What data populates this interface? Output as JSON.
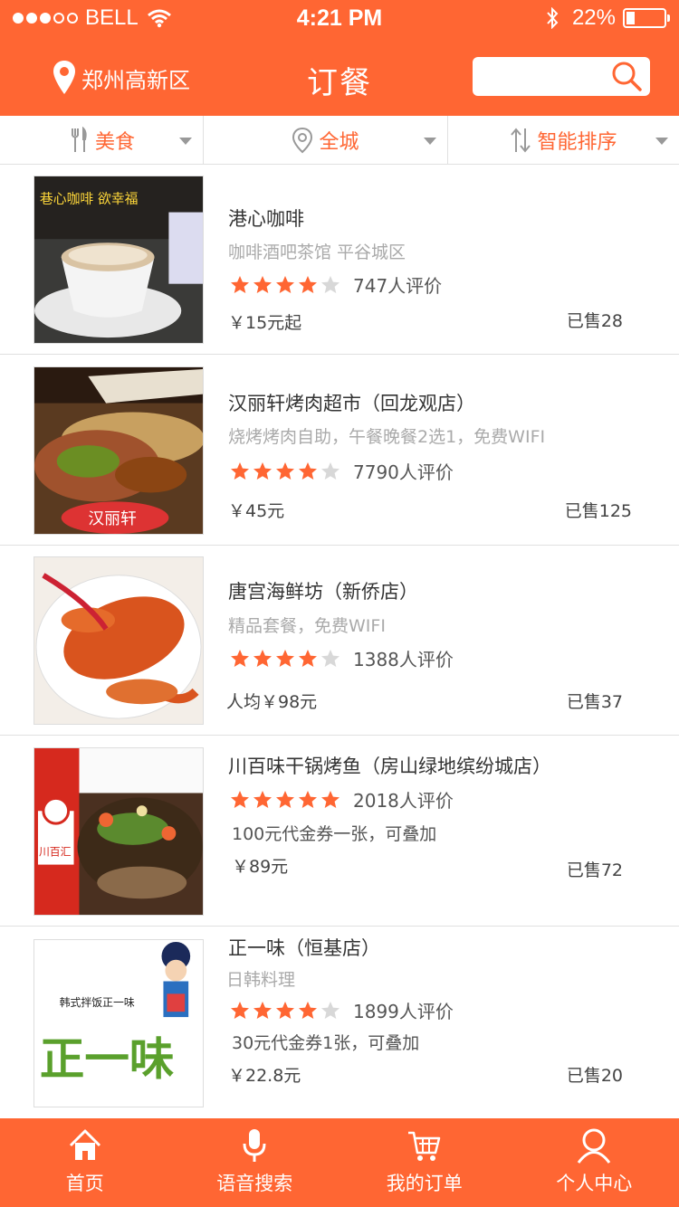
{
  "status_bar": {
    "carrier": "BELL",
    "time": "4:21 PM",
    "battery": "22%",
    "battery_level": 0.22
  },
  "nav": {
    "location": "郑州高新区",
    "title": "订餐",
    "search_placeholder": ""
  },
  "filters": [
    {
      "label": "美食",
      "icon": "fork-knife-icon"
    },
    {
      "label": "全城",
      "icon": "location-pin-icon"
    },
    {
      "label": "智能排序",
      "icon": "sort-arrows-icon"
    }
  ],
  "colors": {
    "brand": "#ff6633",
    "star_on": "#ff6633",
    "star_off": "#d8d8d8"
  },
  "restaurants": [
    {
      "name": "港心咖啡",
      "desc": "咖啡酒吧茶馆 平谷城区",
      "rating": 4,
      "reviews": "747人评价",
      "price": "￥15元起",
      "sold": "已售28",
      "image": "coffee-photo"
    },
    {
      "name": "汉丽轩烤肉超市（回龙观店）",
      "desc": "烧烤烤肉自助，午餐晚餐2选1，免费WIFI",
      "rating": 4,
      "reviews": "7790人评价",
      "price": "￥45元",
      "sold": "已售125",
      "image": "bbq-buffet-photo"
    },
    {
      "name": "唐宫海鲜坊（新侨店）",
      "desc": "精品套餐，免费WIFI",
      "rating": 4,
      "reviews": "1388人评价",
      "price": "人均￥98元",
      "sold": "已售37",
      "image": "lobster-photo"
    },
    {
      "name": "川百味干锅烤鱼（房山绿地缤纷城店）",
      "desc": "",
      "rating": 5,
      "reviews": "2018人评价",
      "extra": "100元代金券一张，可叠加",
      "price": "￥89元",
      "sold": "已售72",
      "image": "grilled-fish-photo"
    },
    {
      "name": "正一味（恒基店）",
      "desc": "日韩料理",
      "rating": 4,
      "reviews": "1899人评价",
      "extra": "30元代金券1张，可叠加",
      "price": "￥22.8元",
      "sold": "已售20",
      "image": "korean-logo-image"
    }
  ],
  "image_text": {
    "coffee": "巷心咖啡 欲幸福",
    "bbq": "汉丽轩",
    "fish": "川百汇",
    "korean_tag": "韩式拌饭正一味",
    "korean_logo": "正一味"
  },
  "tabs": [
    {
      "label": "首页",
      "icon": "home-icon"
    },
    {
      "label": "语音搜索",
      "icon": "microphone-icon"
    },
    {
      "label": "我的订单",
      "icon": "cart-icon"
    },
    {
      "label": "个人中心",
      "icon": "user-icon"
    }
  ]
}
